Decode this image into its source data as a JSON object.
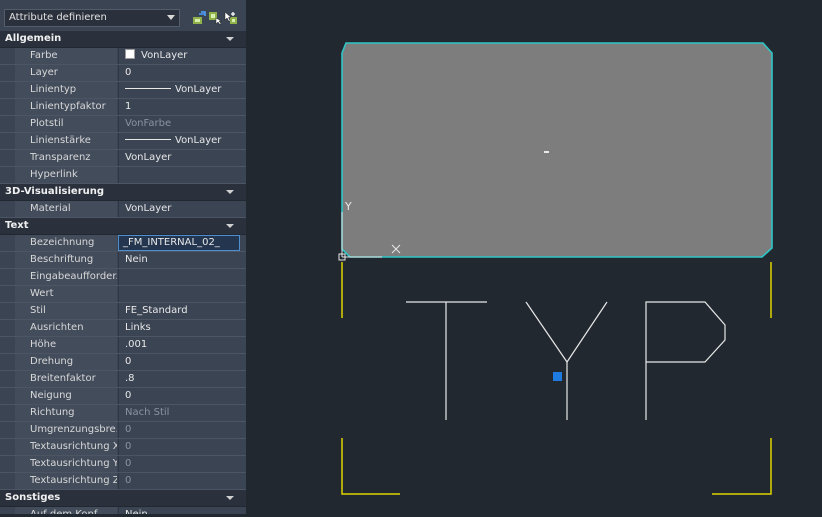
{
  "palette": {
    "object_type": "Attribute definieren",
    "icons": [
      "quick-select-icon",
      "select-objects-icon",
      "toggle-pickadd-icon"
    ]
  },
  "categories": [
    {
      "label": "Allgemein",
      "rows": [
        {
          "name": "Farbe",
          "value": "VonLayer",
          "kind": "color",
          "color": "#ffffff"
        },
        {
          "name": "Layer",
          "value": "0"
        },
        {
          "name": "Linientyp",
          "value": "VonLayer",
          "kind": "line"
        },
        {
          "name": "Linientypfaktor",
          "value": "1"
        },
        {
          "name": "Plotstil",
          "value": "VonFarbe",
          "disabled": true
        },
        {
          "name": "Linienstärke",
          "value": "VonLayer",
          "kind": "line"
        },
        {
          "name": "Transparenz",
          "value": "VonLayer"
        },
        {
          "name": "Hyperlink",
          "value": ""
        }
      ]
    },
    {
      "label": "3D-Visualisierung",
      "rows": [
        {
          "name": "Material",
          "value": "VonLayer"
        }
      ]
    },
    {
      "label": "Text",
      "rows": [
        {
          "name": "Bezeichnung",
          "value": "_FM_INTERNAL_02_",
          "active": true
        },
        {
          "name": "Beschriftung",
          "value": "Nein"
        },
        {
          "name": "Eingabeaufforder...",
          "value": ""
        },
        {
          "name": "Wert",
          "value": ""
        },
        {
          "name": "Stil",
          "value": "FE_Standard"
        },
        {
          "name": "Ausrichten",
          "value": "Links"
        },
        {
          "name": "Höhe",
          "value": ".001"
        },
        {
          "name": "Drehung",
          "value": "0"
        },
        {
          "name": "Breitenfaktor",
          "value": ".8"
        },
        {
          "name": "Neigung",
          "value": "0"
        },
        {
          "name": "Richtung",
          "value": "Nach Stil",
          "disabled": true
        },
        {
          "name": "Umgrenzungsbre...",
          "value": "0",
          "disabled": true
        },
        {
          "name": "Textausrichtung X",
          "value": "0",
          "disabled": true
        },
        {
          "name": "Textausrichtung Y",
          "value": "0",
          "disabled": true
        },
        {
          "name": "Textausrichtung Z",
          "value": "0",
          "disabled": true
        }
      ]
    },
    {
      "label": "Sonstiges",
      "rows": [
        {
          "name": "Auf dem Kopf",
          "value": "Nein"
        }
      ]
    }
  ],
  "drawing": {
    "ucs_y_label": "Y",
    "colors": {
      "background": "#212830",
      "rectangle_fill": "#7d7d7d",
      "rectangle_outline": "#2ec6c6",
      "text_lines": "#e8e8e8",
      "brackets": "#e0d400",
      "grip": "#1e7be0"
    }
  }
}
